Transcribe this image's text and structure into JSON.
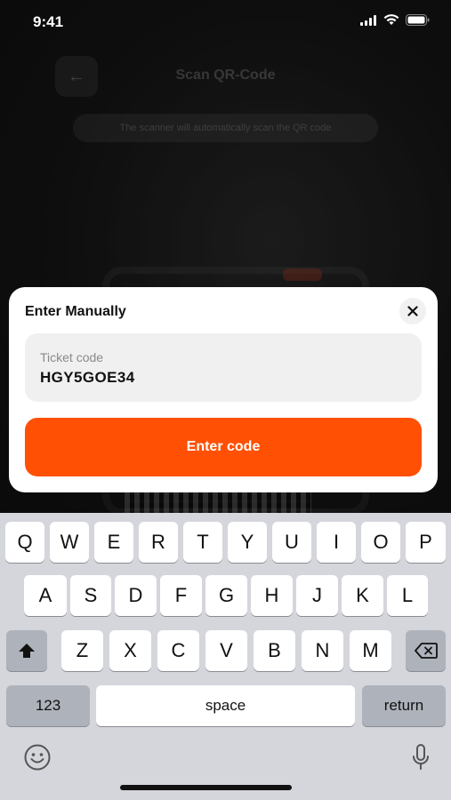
{
  "status_bar": {
    "time": "9:41",
    "icons": [
      "cellular-signal-icon",
      "wifi-icon",
      "battery-icon"
    ]
  },
  "background": {
    "back_icon": "arrow-left-icon",
    "title": "Scan QR-Code",
    "subtitle": "The scanner will automatically scan the QR code"
  },
  "modal": {
    "title": "Enter Manually",
    "close_icon": "close-icon",
    "field": {
      "label": "Ticket code",
      "value": "HGY5GOE34"
    },
    "submit_label": "Enter code"
  },
  "keyboard": {
    "row1": [
      "Q",
      "W",
      "E",
      "R",
      "T",
      "Y",
      "U",
      "I",
      "O",
      "P"
    ],
    "row2": [
      "A",
      "S",
      "D",
      "F",
      "G",
      "H",
      "J",
      "K",
      "L"
    ],
    "row3": [
      "Z",
      "X",
      "C",
      "V",
      "B",
      "N",
      "M"
    ],
    "numbers_label": "123",
    "space_label": "space",
    "return_label": "return",
    "shift_icon": "shift-icon",
    "delete_icon": "backspace-icon",
    "emoji_icon": "emoji-icon",
    "mic_icon": "microphone-icon"
  },
  "colors": {
    "accent": "#ff5004",
    "keyboard_bg": "#d4d6dc",
    "modal_bg": "#ffffff"
  }
}
